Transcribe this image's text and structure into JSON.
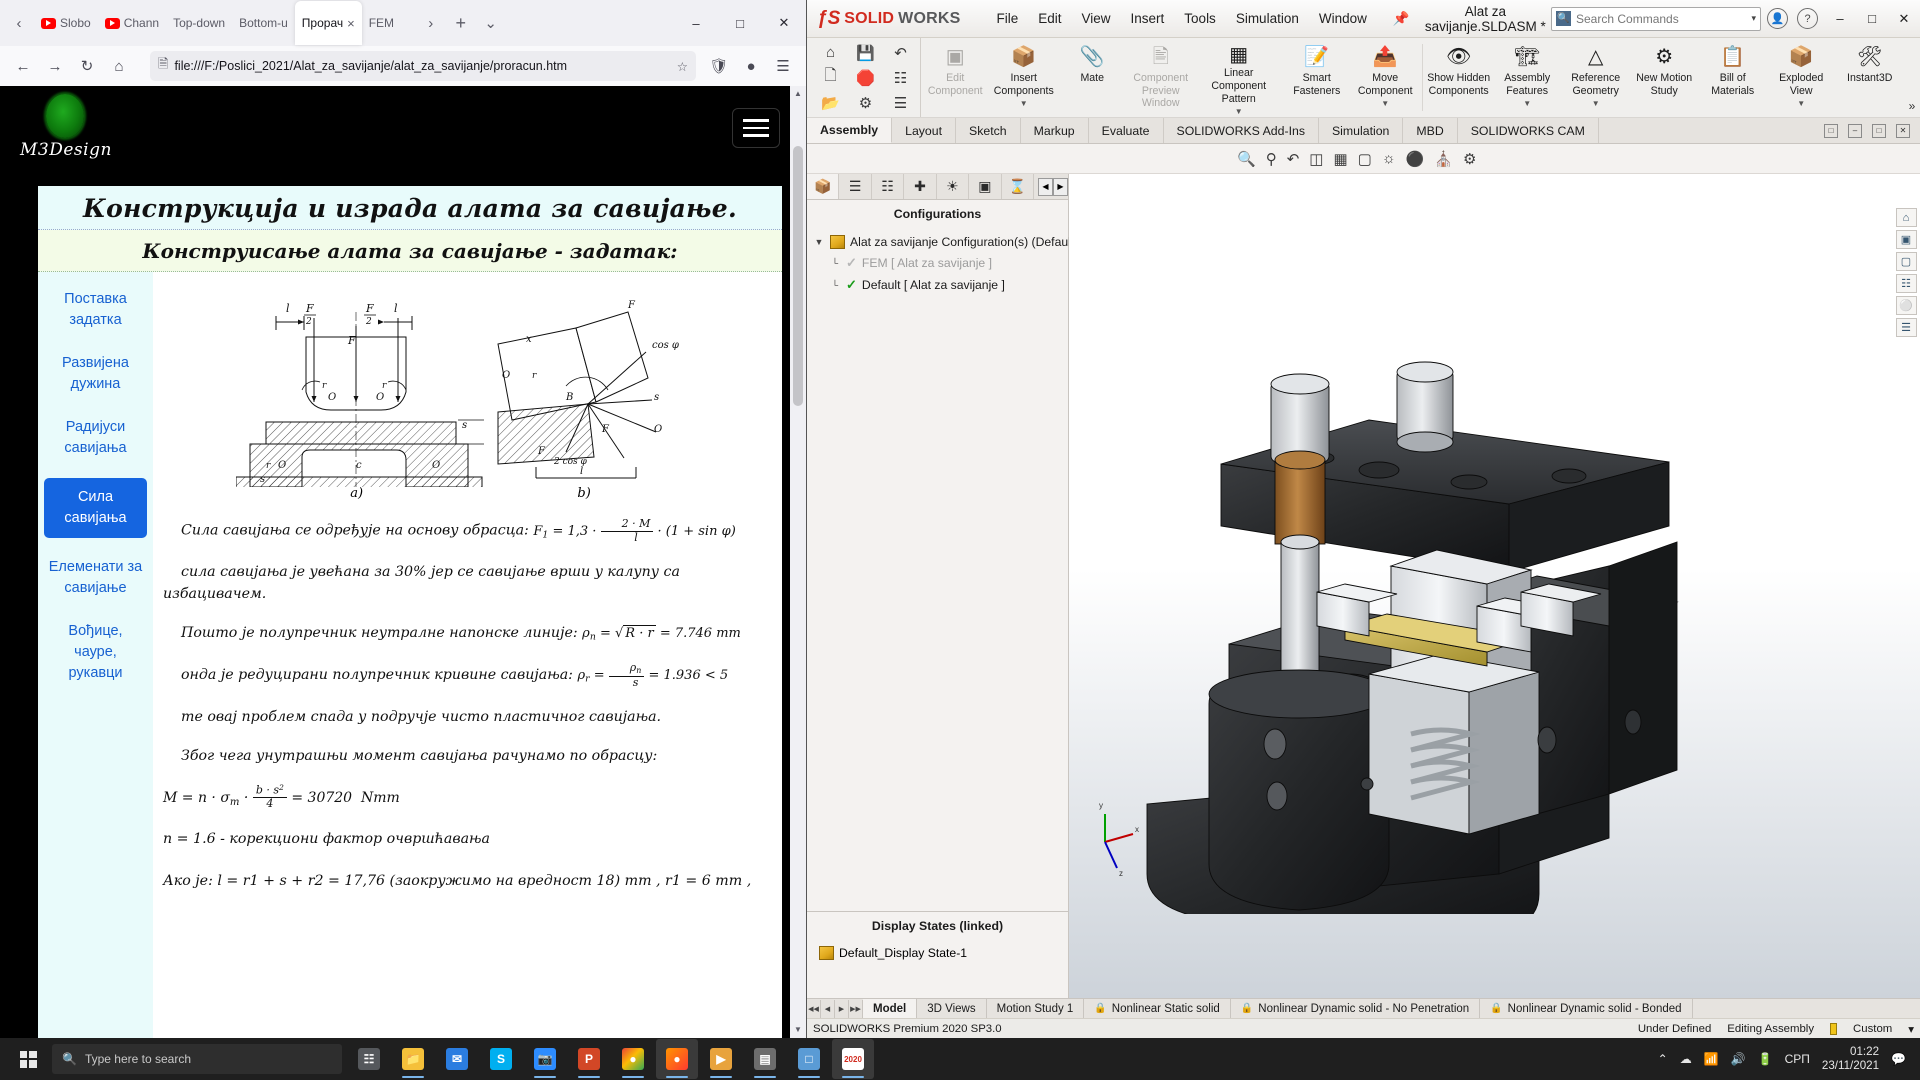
{
  "browser": {
    "tabs": [
      {
        "label": "Slobo",
        "icon": "youtube-icon",
        "active": false
      },
      {
        "label": "Chann",
        "icon": "youtube-icon",
        "active": false
      },
      {
        "label": "Top-down",
        "icon": "",
        "active": false
      },
      {
        "label": "Bottom-u",
        "icon": "",
        "active": false
      },
      {
        "label": "Прорач",
        "icon": "",
        "active": true
      },
      {
        "label": "FEM",
        "icon": "",
        "active": false
      }
    ],
    "tab_close_label": "×",
    "new_tab_label": "+",
    "list_all_tabs_label": "⌄",
    "scroll_left_label": "‹",
    "scroll_right_label": "›",
    "nav": {
      "back": "←",
      "forward": "→",
      "reload": "↻",
      "home": "⌂"
    },
    "url": "file:///F:/Poslici_2021/Alat_za_savijanje/alat_za_savijanje/proracun.htm",
    "url_doc_icon": "page-icon",
    "bookmark_icon": "☆",
    "toolbar_icons": [
      "shield-icon",
      "account-icon",
      "app-menu-icon"
    ],
    "window_controls": {
      "minimize": "–",
      "maximize": "□",
      "close": "✕"
    }
  },
  "page": {
    "logo_text": "M3Design",
    "menu_button": "hamburger-menu",
    "title": "Конструкција и израда алата за савијање.",
    "subtitle": "Конструисање алата за савијање - задатак:",
    "nav_items": [
      {
        "label": "Поставка задатка",
        "active": false
      },
      {
        "label": "Развијена дужина",
        "active": false
      },
      {
        "label": "Радијуси савијања",
        "active": false
      },
      {
        "label": "Сила савијања",
        "active": true
      },
      {
        "label": "Елеменати за савијање",
        "active": false
      },
      {
        "label": "Вођице, чауре, рукавци",
        "active": false
      }
    ],
    "figure_captions": [
      "a)",
      "b)"
    ],
    "paragraphs": [
      {
        "text": "Сила савијања се одређује на основу обрасца:",
        "formula": "F1 = 1,3 · (2·M / l) · (1 + sin φ)"
      },
      {
        "text": "сила савијања је увећана за 30% јер се савијање врши у калупу са избацивачем.",
        "formula": ""
      },
      {
        "text": "Пошто је полупречник неутралне напонске линије:",
        "formula": "ρn = √(R · r) = 7.746 mm"
      },
      {
        "text": "онда је редуцирани полупречник кривине савијања:",
        "formula": "ρr = ρn / s = 1.936 < 5"
      },
      {
        "text": "те овај проблем спада у подручје чисто пластичног савијања.",
        "formula": ""
      },
      {
        "text": "Због чега унутрашњи момент савијања рачунамо по обрасцу:",
        "formula": ""
      },
      {
        "text": "",
        "formula": "M = n · σm · (b·s² / 4) = 30720  Nmm"
      },
      {
        "text": "n = 1.6 - корекциони фактор очвршћавања",
        "formula": ""
      },
      {
        "text": "Ако је: l = r1 + s + r2 = 17,76 (заокружимо на вредност 18) mm , r1 = 6 mm ,",
        "formula": ""
      }
    ]
  },
  "solidworks": {
    "logo": {
      "mark": "ƒS",
      "solid": "SOLID",
      "works": "WORKS"
    },
    "menu": [
      "File",
      "Edit",
      "View",
      "Insert",
      "Tools",
      "Simulation",
      "Window"
    ],
    "pin_icon": "pin-icon",
    "document_title": "Alat za savijanje.SLDASM *",
    "search_placeholder": "Search Commands",
    "search_dropdown": "▾",
    "title_icons": [
      "user-account-icon",
      "help-icon"
    ],
    "window_controls": {
      "minimize": "–",
      "maximize": "□",
      "close": "✕"
    },
    "quick_access": [
      "home-icon",
      "save-icon",
      "save-dropdown",
      "undo-icon",
      "undo-dropdown",
      "new-doc-icon",
      "new-doc-dropdown",
      "rebuild-icon",
      "options-list-icon",
      "open-icon",
      "open-dropdown",
      "settings-icon",
      "settings-dropdown",
      "properties-icon"
    ],
    "ribbon": [
      {
        "label": "Edit Component",
        "icon": "edit-component-icon",
        "disabled": true,
        "caret": false
      },
      {
        "label": "Insert Components",
        "icon": "insert-components-icon",
        "disabled": false,
        "caret": true
      },
      {
        "label": "Mate",
        "icon": "mate-icon",
        "disabled": false,
        "caret": false
      },
      {
        "label": "Component Preview Window",
        "icon": "component-preview-icon",
        "disabled": true,
        "caret": false
      },
      {
        "label": "Linear Component Pattern",
        "icon": "linear-pattern-icon",
        "disabled": false,
        "caret": true
      },
      {
        "label": "Smart Fasteners",
        "icon": "smart-fasteners-icon",
        "disabled": false,
        "caret": false
      },
      {
        "label": "Move Component",
        "icon": "move-component-icon",
        "disabled": false,
        "caret": true
      },
      {
        "label": "Show Hidden Components",
        "icon": "show-hidden-icon",
        "disabled": false,
        "caret": false
      },
      {
        "label": "Assembly Features",
        "icon": "assembly-features-icon",
        "disabled": false,
        "caret": true
      },
      {
        "label": "Reference Geometry",
        "icon": "reference-geometry-icon",
        "disabled": false,
        "caret": true
      },
      {
        "label": "New Motion Study",
        "icon": "new-motion-study-icon",
        "disabled": false,
        "caret": false
      },
      {
        "label": "Bill of Materials",
        "icon": "bill-of-materials-icon",
        "disabled": false,
        "caret": false
      },
      {
        "label": "Exploded View",
        "icon": "exploded-view-icon",
        "disabled": false,
        "caret": true
      },
      {
        "label": "Instant3D",
        "icon": "instant3d-icon",
        "disabled": false,
        "caret": false
      }
    ],
    "command_tabs": [
      {
        "label": "Assembly",
        "active": true
      },
      {
        "label": "Layout",
        "active": false
      },
      {
        "label": "Sketch",
        "active": false
      },
      {
        "label": "Markup",
        "active": false
      },
      {
        "label": "Evaluate",
        "active": false
      },
      {
        "label": "SOLIDWORKS Add-Ins",
        "active": false
      },
      {
        "label": "Simulation",
        "active": false
      },
      {
        "label": "MBD",
        "active": false
      },
      {
        "label": "SOLIDWORKS CAM",
        "active": false
      }
    ],
    "view_tools": [
      "zoom-to-fit-icon",
      "zoom-area-icon",
      "previous-view-icon",
      "section-view-icon",
      "view-orientation-icon",
      "display-style-icon",
      "hide-show-icon",
      "appearances-icon",
      "scene-icon",
      "view-settings-icon"
    ],
    "tree_tabs": [
      {
        "icon": "feature-tree-icon",
        "active": true
      },
      {
        "icon": "property-manager-icon",
        "active": false
      },
      {
        "icon": "configuration-manager-icon",
        "active": false
      },
      {
        "icon": "dimxpert-icon",
        "active": false
      },
      {
        "icon": "display-manager-icon",
        "active": false
      },
      {
        "icon": "render-tools-icon",
        "active": false
      },
      {
        "icon": "simulation-tree-icon",
        "active": false
      }
    ],
    "tree_header": "Configurations",
    "tree_items": [
      {
        "label": "Alat za savijanje Configuration(s)  (Default)",
        "icon": "assembly-icon",
        "level": 0,
        "greyed": false
      },
      {
        "label": "FEM [ Alat za savijanje ]",
        "icon": "config-check-grey-icon",
        "level": 1,
        "greyed": true
      },
      {
        "label": "Default [ Alat za savijanje ]",
        "icon": "config-check-icon",
        "level": 1,
        "greyed": false
      }
    ],
    "display_states_header": "Display States (linked)",
    "display_states": [
      {
        "label": "Default_Display State-1",
        "icon": "display-state-icon"
      }
    ],
    "doc_tabs": [
      {
        "label": "Model",
        "active": true,
        "lock": false
      },
      {
        "label": "3D Views",
        "active": false,
        "lock": false
      },
      {
        "label": "Motion Study 1",
        "active": false,
        "lock": false
      },
      {
        "label": "Nonlinear Static solid",
        "active": false,
        "lock": true
      },
      {
        "label": "Nonlinear Dynamic solid - No Penetration",
        "active": false,
        "lock": true
      },
      {
        "label": "Nonlinear Dynamic solid - Bonded",
        "active": false,
        "lock": true
      }
    ],
    "status_bar": {
      "left": "SOLIDWORKS Premium 2020 SP3.0",
      "state": "Under Defined",
      "mode": "Editing Assembly",
      "units": "Custom",
      "units_caret": "▾"
    },
    "triad_labels": {
      "x": "x",
      "y": "y",
      "z": "z"
    }
  },
  "taskbar": {
    "start_icon": "windows-start-icon",
    "search_placeholder": "Type here to search",
    "search_icon": "search-icon",
    "apps": [
      {
        "name": "task-view-icon",
        "glyph": "▣",
        "color": "#c8c8c8",
        "running": false,
        "active": false
      },
      {
        "name": "file-explorer-icon",
        "glyph": "▤",
        "color": "#f5c03a",
        "running": true,
        "active": false
      },
      {
        "name": "mail-icon",
        "glyph": "✉",
        "color": "#2b7de0",
        "running": false,
        "active": false
      },
      {
        "name": "skype-icon",
        "glyph": "S",
        "color": "#00aff0",
        "running": false,
        "active": false
      },
      {
        "name": "zoom-meeting-icon",
        "glyph": "▢",
        "color": "#2d8cff",
        "running": true,
        "active": false
      },
      {
        "name": "powerpoint-icon",
        "glyph": "P",
        "color": "#d24726",
        "running": true,
        "active": false
      },
      {
        "name": "chrome-icon",
        "glyph": "●",
        "color": "#4285f4",
        "running": true,
        "active": false
      },
      {
        "name": "firefox-icon",
        "glyph": "●",
        "color": "#ff7139",
        "running": true,
        "active": true
      },
      {
        "name": "media-player-icon",
        "glyph": "▶",
        "color": "#e8a33d",
        "running": true,
        "active": false
      },
      {
        "name": "calculator-icon",
        "glyph": "▦",
        "color": "#6d6d6d",
        "running": true,
        "active": false
      },
      {
        "name": "notepad-icon",
        "glyph": "□",
        "color": "#5a9bd5",
        "running": true,
        "active": false
      },
      {
        "name": "solidworks-icon",
        "glyph": "2020",
        "color": "#d12b1f",
        "running": true,
        "active": true
      }
    ],
    "tray": {
      "show_hidden": "⌃",
      "icons": [
        "onedrive-icon",
        "network-icon",
        "volume-icon",
        "battery-icon"
      ],
      "language": "СРП",
      "time": "01:22",
      "date": "23/11/2021",
      "notification_icon": "notification-icon"
    }
  }
}
